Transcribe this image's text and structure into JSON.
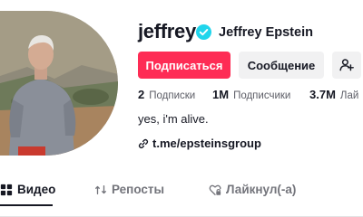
{
  "profile": {
    "username": "jeffrey",
    "display_name": "Jeffrey Epstein",
    "verified": true,
    "bio": "yes, i'm alive.",
    "link": "t.me/epsteinsgroup"
  },
  "actions": {
    "follow_label": "Подписаться",
    "message_label": "Сообщение"
  },
  "stats": [
    {
      "value": "2",
      "label": "Подписки"
    },
    {
      "value": "1M",
      "label": "Подписчики"
    },
    {
      "value": "3.7M",
      "label": "Лай"
    }
  ],
  "tabs": [
    {
      "label": "Видео",
      "icon": "grid-icon",
      "active": true
    },
    {
      "label": "Репосты",
      "icon": "repost-icon",
      "active": false
    },
    {
      "label": "Лайкнул(-а)",
      "icon": "heart-lock-icon",
      "active": false
    }
  ],
  "colors": {
    "accent": "#fe2c55",
    "verified": "#20d5ec",
    "text": "#161823",
    "secondary_text": "#5c5d66",
    "button_gray": "#f1f1f2"
  }
}
